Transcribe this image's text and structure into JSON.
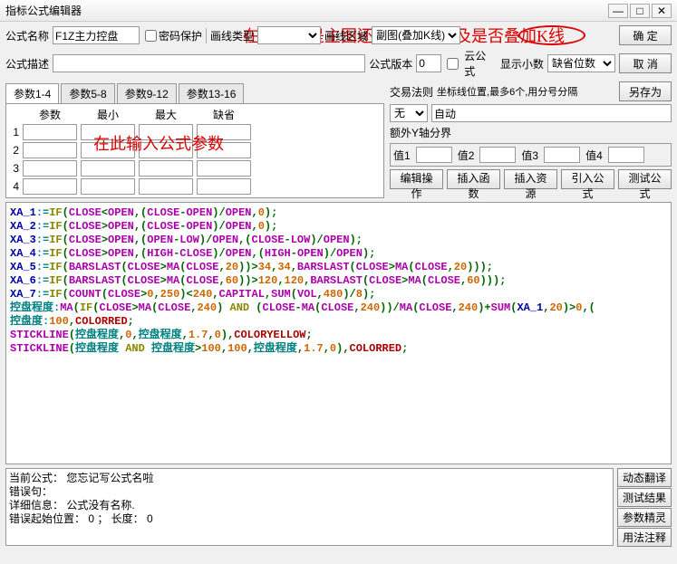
{
  "window": {
    "title": "指标公式编辑器"
  },
  "labels": {
    "name": "公式名称",
    "pwd": "密码保护",
    "plot_type": "画线类型",
    "region": "画线区域",
    "desc": "公式描述",
    "version": "公式版本",
    "cloud": "云公式",
    "decimal": "显示小数",
    "trade_rule": "交易法则",
    "coord_hint": "坐标线位置,最多6个,用分号分隔",
    "none": "无",
    "auto": "自动",
    "extra_y": "额外Y轴分界",
    "v1": "值1",
    "v2": "值2",
    "v3": "值3",
    "v4": "值4",
    "ok": "确  定",
    "cancel": "取  消",
    "saveas": "另存为",
    "edit_op": "编辑操作",
    "ins_fn": "插入函数",
    "ins_res": "插入资源",
    "imp": "引入公式",
    "test": "测试公式",
    "dyn": "动态翻译",
    "test_res": "测试结果",
    "param_wiz": "参数精灵",
    "usage": "用法注释"
  },
  "fields": {
    "name": "F1Z主力控盘",
    "plot_type": "副图(叠加K线)",
    "region": "",
    "desc": "",
    "version": "0",
    "decimal": "缺省位数",
    "coord": "",
    "v1": "",
    "v2": "",
    "v3": "",
    "v4": ""
  },
  "annotations": {
    "top": "在此选择是主图还是副图，以及是否叠加K线",
    "params": "在此输入公式参数"
  },
  "param_tabs": [
    "参数1-4",
    "参数5-8",
    "参数9-12",
    "参数13-16"
  ],
  "param_headers": [
    "参数",
    "最小",
    "最大",
    "缺省"
  ],
  "param_rows": [
    "1",
    "2",
    "3",
    "4"
  ],
  "code_lines": [
    [
      [
        "id",
        "XA_1"
      ],
      [
        "op",
        ":="
      ],
      [
        "kw",
        "IF"
      ],
      [
        "sym",
        "("
      ],
      [
        "fn",
        "CLOSE"
      ],
      [
        "sym",
        "<"
      ],
      [
        "fn",
        "OPEN"
      ],
      [
        "sym",
        ",("
      ],
      [
        "fn",
        "CLOSE"
      ],
      [
        "sym",
        "-"
      ],
      [
        "fn",
        "OPEN"
      ],
      [
        "sym",
        ")/"
      ],
      [
        "fn",
        "OPEN"
      ],
      [
        "sym",
        ","
      ],
      [
        "num",
        "0"
      ],
      [
        "sym",
        ");"
      ]
    ],
    [
      [
        "id",
        "XA_2"
      ],
      [
        "op",
        ":="
      ],
      [
        "kw",
        "IF"
      ],
      [
        "sym",
        "("
      ],
      [
        "fn",
        "CLOSE"
      ],
      [
        "sym",
        ">"
      ],
      [
        "fn",
        "OPEN"
      ],
      [
        "sym",
        ",("
      ],
      [
        "fn",
        "CLOSE"
      ],
      [
        "sym",
        "-"
      ],
      [
        "fn",
        "OPEN"
      ],
      [
        "sym",
        ")/"
      ],
      [
        "fn",
        "OPEN"
      ],
      [
        "sym",
        ","
      ],
      [
        "num",
        "0"
      ],
      [
        "sym",
        ");"
      ]
    ],
    [
      [
        "id",
        "XA_3"
      ],
      [
        "op",
        ":="
      ],
      [
        "kw",
        "IF"
      ],
      [
        "sym",
        "("
      ],
      [
        "fn",
        "CLOSE"
      ],
      [
        "sym",
        ">"
      ],
      [
        "fn",
        "OPEN"
      ],
      [
        "sym",
        ",("
      ],
      [
        "fn",
        "OPEN"
      ],
      [
        "sym",
        "-"
      ],
      [
        "fn",
        "LOW"
      ],
      [
        "sym",
        ")/"
      ],
      [
        "fn",
        "OPEN"
      ],
      [
        "sym",
        ",("
      ],
      [
        "fn",
        "CLOSE"
      ],
      [
        "sym",
        "-"
      ],
      [
        "fn",
        "LOW"
      ],
      [
        "sym",
        ")/"
      ],
      [
        "fn",
        "OPEN"
      ],
      [
        "sym",
        ");"
      ]
    ],
    [
      [
        "id",
        "XA_4"
      ],
      [
        "op",
        ":="
      ],
      [
        "kw",
        "IF"
      ],
      [
        "sym",
        "("
      ],
      [
        "fn",
        "CLOSE"
      ],
      [
        "sym",
        ">"
      ],
      [
        "fn",
        "OPEN"
      ],
      [
        "sym",
        ",("
      ],
      [
        "fn",
        "HIGH"
      ],
      [
        "sym",
        "-"
      ],
      [
        "fn",
        "CLOSE"
      ],
      [
        "sym",
        ")/"
      ],
      [
        "fn",
        "OPEN"
      ],
      [
        "sym",
        ",("
      ],
      [
        "fn",
        "HIGH"
      ],
      [
        "sym",
        "-"
      ],
      [
        "fn",
        "OPEN"
      ],
      [
        "sym",
        ")/"
      ],
      [
        "fn",
        "OPEN"
      ],
      [
        "sym",
        ");"
      ]
    ],
    [
      [
        "id",
        "XA_5"
      ],
      [
        "op",
        ":="
      ],
      [
        "kw",
        "IF"
      ],
      [
        "sym",
        "("
      ],
      [
        "fn",
        "BARSLAST"
      ],
      [
        "sym",
        "("
      ],
      [
        "fn",
        "CLOSE"
      ],
      [
        "sym",
        ">"
      ],
      [
        "fn",
        "MA"
      ],
      [
        "sym",
        "("
      ],
      [
        "fn",
        "CLOSE"
      ],
      [
        "sym",
        ","
      ],
      [
        "num",
        "20"
      ],
      [
        "sym",
        "))>"
      ],
      [
        "num",
        "34"
      ],
      [
        "sym",
        ","
      ],
      [
        "num",
        "34"
      ],
      [
        "sym",
        ","
      ],
      [
        "fn",
        "BARSLAST"
      ],
      [
        "sym",
        "("
      ],
      [
        "fn",
        "CLOSE"
      ],
      [
        "sym",
        ">"
      ],
      [
        "fn",
        "MA"
      ],
      [
        "sym",
        "("
      ],
      [
        "fn",
        "CLOSE"
      ],
      [
        "sym",
        ","
      ],
      [
        "num",
        "20"
      ],
      [
        "sym",
        ")));"
      ]
    ],
    [
      [
        "id",
        "XA_6"
      ],
      [
        "op",
        ":="
      ],
      [
        "kw",
        "IF"
      ],
      [
        "sym",
        "("
      ],
      [
        "fn",
        "BARSLAST"
      ],
      [
        "sym",
        "("
      ],
      [
        "fn",
        "CLOSE"
      ],
      [
        "sym",
        ">"
      ],
      [
        "fn",
        "MA"
      ],
      [
        "sym",
        "("
      ],
      [
        "fn",
        "CLOSE"
      ],
      [
        "sym",
        ","
      ],
      [
        "num",
        "60"
      ],
      [
        "sym",
        "))>"
      ],
      [
        "num",
        "120"
      ],
      [
        "sym",
        ","
      ],
      [
        "num",
        "120"
      ],
      [
        "sym",
        ","
      ],
      [
        "fn",
        "BARSLAST"
      ],
      [
        "sym",
        "("
      ],
      [
        "fn",
        "CLOSE"
      ],
      [
        "sym",
        ">"
      ],
      [
        "fn",
        "MA"
      ],
      [
        "sym",
        "("
      ],
      [
        "fn",
        "CLOSE"
      ],
      [
        "sym",
        ","
      ],
      [
        "num",
        "60"
      ],
      [
        "sym",
        ")));"
      ]
    ],
    [
      [
        "id",
        "XA_7"
      ],
      [
        "op",
        ":="
      ],
      [
        "kw",
        "IF"
      ],
      [
        "sym",
        "("
      ],
      [
        "fn",
        "COUNT"
      ],
      [
        "sym",
        "("
      ],
      [
        "fn",
        "CLOSE"
      ],
      [
        "sym",
        ">"
      ],
      [
        "num",
        "0"
      ],
      [
        "sym",
        ","
      ],
      [
        "num",
        "250"
      ],
      [
        "sym",
        ")<"
      ],
      [
        "num",
        "240"
      ],
      [
        "sym",
        ","
      ],
      [
        "fn",
        "CAPITAL"
      ],
      [
        "sym",
        ","
      ],
      [
        "fn",
        "SUM"
      ],
      [
        "sym",
        "("
      ],
      [
        "fn",
        "VOL"
      ],
      [
        "sym",
        ","
      ],
      [
        "num",
        "480"
      ],
      [
        "sym",
        ")/"
      ],
      [
        "num",
        "8"
      ],
      [
        "sym",
        ");"
      ]
    ],
    [
      [
        "var",
        "控盘程度"
      ],
      [
        "op",
        ":"
      ],
      [
        "fn",
        "MA"
      ],
      [
        "sym",
        "("
      ],
      [
        "kw",
        "IF"
      ],
      [
        "sym",
        "("
      ],
      [
        "fn",
        "CLOSE"
      ],
      [
        "sym",
        ">"
      ],
      [
        "fn",
        "MA"
      ],
      [
        "sym",
        "("
      ],
      [
        "fn",
        "CLOSE"
      ],
      [
        "sym",
        ","
      ],
      [
        "num",
        "240"
      ],
      [
        "sym",
        ") "
      ],
      [
        "kw",
        "AND"
      ],
      [
        "sym",
        " ("
      ],
      [
        "fn",
        "CLOSE"
      ],
      [
        "sym",
        "-"
      ],
      [
        "fn",
        "MA"
      ],
      [
        "sym",
        "("
      ],
      [
        "fn",
        "CLOSE"
      ],
      [
        "sym",
        ","
      ],
      [
        "num",
        "240"
      ],
      [
        "sym",
        "))/"
      ],
      [
        "fn",
        "MA"
      ],
      [
        "sym",
        "("
      ],
      [
        "fn",
        "CLOSE"
      ],
      [
        "sym",
        ","
      ],
      [
        "num",
        "240"
      ],
      [
        "sym",
        ")+"
      ],
      [
        "fn",
        "SUM"
      ],
      [
        "sym",
        "("
      ],
      [
        "id",
        "XA_1"
      ],
      [
        "sym",
        ","
      ],
      [
        "num",
        "20"
      ],
      [
        "sym",
        ")>"
      ],
      [
        "num",
        "0"
      ],
      [
        "sym",
        ",("
      ]
    ],
    [
      [
        "var",
        "控盘度"
      ],
      [
        "op",
        ":"
      ],
      [
        "num",
        "100"
      ],
      [
        "sym",
        ","
      ],
      [
        "red",
        "COLORRED"
      ],
      [
        "sym",
        ";"
      ]
    ],
    [
      [
        "fn",
        "STICKLINE"
      ],
      [
        "sym",
        "("
      ],
      [
        "var",
        "控盘程度"
      ],
      [
        "sym",
        ","
      ],
      [
        "num",
        "0"
      ],
      [
        "sym",
        ","
      ],
      [
        "var",
        "控盘程度"
      ],
      [
        "sym",
        ","
      ],
      [
        "num",
        "1.7"
      ],
      [
        "sym",
        ","
      ],
      [
        "num",
        "0"
      ],
      [
        "sym",
        ")"
      ],
      [
        "sym",
        ","
      ],
      [
        "red",
        "COLORYELLOW"
      ],
      [
        "sym",
        ";"
      ]
    ],
    [
      [
        "fn",
        "STICKLINE"
      ],
      [
        "sym",
        "("
      ],
      [
        "var",
        "控盘程度 "
      ],
      [
        "kw",
        "AND"
      ],
      [
        "sym",
        " "
      ],
      [
        "var",
        "控盘程度"
      ],
      [
        "sym",
        ">"
      ],
      [
        "num",
        "100"
      ],
      [
        "sym",
        ","
      ],
      [
        "num",
        "100"
      ],
      [
        "sym",
        ","
      ],
      [
        "var",
        "控盘程度"
      ],
      [
        "sym",
        ","
      ],
      [
        "num",
        "1.7"
      ],
      [
        "sym",
        ","
      ],
      [
        "num",
        "0"
      ],
      [
        "sym",
        ")"
      ],
      [
        "sym",
        ","
      ],
      [
        "red",
        "COLORRED"
      ],
      [
        "sym",
        ";"
      ]
    ]
  ],
  "msgs": {
    "l1": "当前公式： 您忘记写公式名啦",
    "l2": "错误句：",
    "l3": "详细信息： 公式没有名称.",
    "l4": "错误起始位置： 0 ； 长度： 0"
  }
}
